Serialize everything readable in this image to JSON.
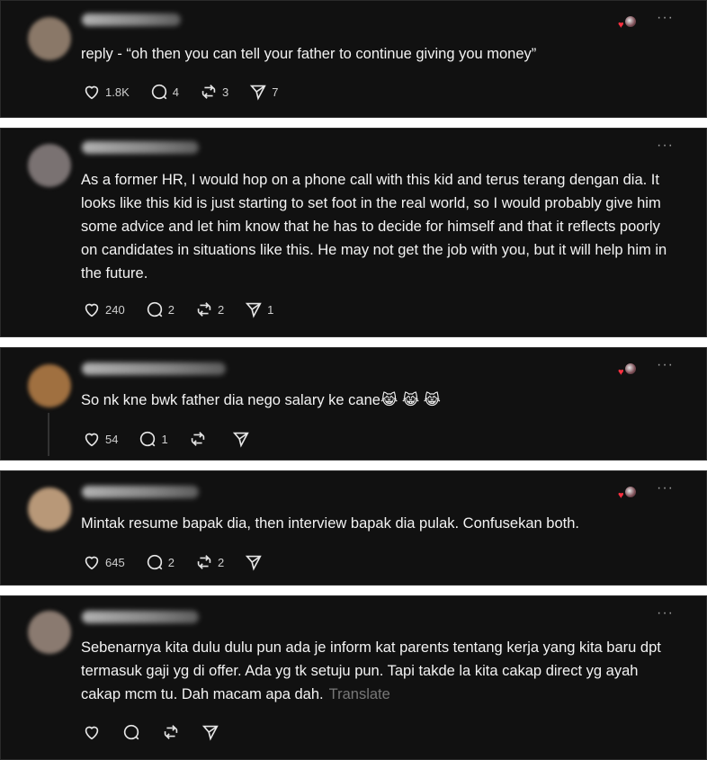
{
  "comments": [
    {
      "text": "reply - “oh then you can tell your father to continue giving you money”",
      "likes": "1.8K",
      "replies": "4",
      "reposts": "3",
      "shares": "7",
      "avatar_color": "#8a7868",
      "liked_by_author": true
    },
    {
      "text": "As a former HR, I would hop on a phone call with this kid and terus terang dengan dia. It looks like this kid is just starting to set foot in the real world, so I would probably give him some advice and let him know that he has to decide for himself and that it reflects poorly on candidates in situations like this. He may not get the job with you, but it will help him in the future.",
      "likes": "240",
      "replies": "2",
      "reposts": "2",
      "shares": "1",
      "avatar_color": "#7a7272",
      "liked_by_author": false
    },
    {
      "text": "So nk kne bwk father dia nego salary ke cane😹 😹 😹",
      "likes": "54",
      "replies": "1",
      "reposts": "",
      "shares": "",
      "avatar_color": "#a07040",
      "liked_by_author": true
    },
    {
      "text": "Mintak resume bapak dia, then interview bapak dia pulak. Confusekan both.",
      "likes": "645",
      "replies": "2",
      "reposts": "2",
      "shares": "",
      "avatar_color": "#b89878",
      "liked_by_author": true
    },
    {
      "text": "Sebenarnya kita dulu dulu pun ada je inform kat parents tentang kerja yang kita baru dpt termasuk gaji yg di offer. Ada yg tk setuju pun. Tapi takde la kita cakap direct yg ayah cakap mcm tu. Dah macam apa dah.",
      "translate_label": "Translate",
      "likes": "",
      "replies": "",
      "reposts": "",
      "shares": "",
      "avatar_color": "#8a7a70",
      "liked_by_author": false
    }
  ],
  "more_label": "···",
  "icons": {
    "like": "heart-icon",
    "reply": "comment-icon",
    "repost": "repost-icon",
    "share": "share-icon",
    "more": "more-icon"
  },
  "colors": {
    "background": "#111111",
    "text": "#f3f3f3",
    "muted": "#777777",
    "heart": "#ff3040"
  }
}
